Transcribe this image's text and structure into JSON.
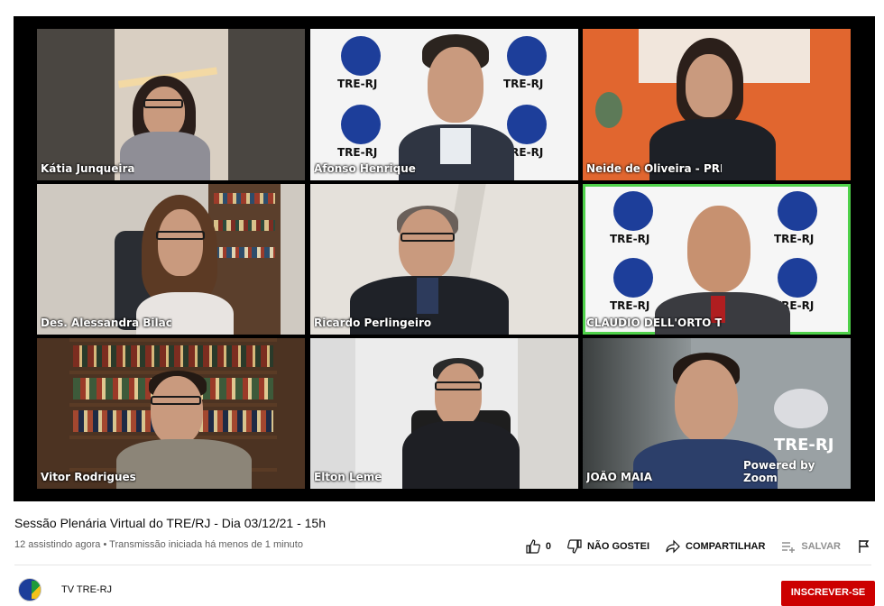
{
  "video": {
    "tiles": [
      {
        "name": "Kátia Junqueira",
        "active": false
      },
      {
        "name": "Afonso Henrique",
        "active": false
      },
      {
        "name": "Neide de Oliveira - PRR (PR...",
        "active": false
      },
      {
        "name": "Des. Alessandra Bilac",
        "active": false
      },
      {
        "name": "Ricardo Perlingeiro",
        "active": false
      },
      {
        "name": "CLAUDIO DELL'ORTO TRE-...",
        "active": true
      },
      {
        "name": "Vitor Rodrigues",
        "active": false
      },
      {
        "name": "Elton Leme",
        "active": false
      },
      {
        "name": "JOÃO MAIA",
        "active": false
      }
    ],
    "logo_text": "TRE-RJ",
    "watermark_logo": "TRE-RJ",
    "watermark_powered": "Powered by Zoom",
    "active_color": "#4fd14a"
  },
  "info": {
    "title": "Sessão Plenária Virtual do TRE/RJ - Dia 03/12/21 - 15h",
    "meta": "12 assistindo agora • Transmissão iniciada há menos de 1 minuto"
  },
  "actions": {
    "like_count": "0",
    "dislike_label": "NÃO GOSTEI",
    "share_label": "COMPARTILHAR",
    "save_label": "SALVAR"
  },
  "channel": {
    "name": "TV TRE-RJ",
    "subscribe_label": "INSCREVER-SE",
    "subscribe_color": "#cc0000"
  }
}
